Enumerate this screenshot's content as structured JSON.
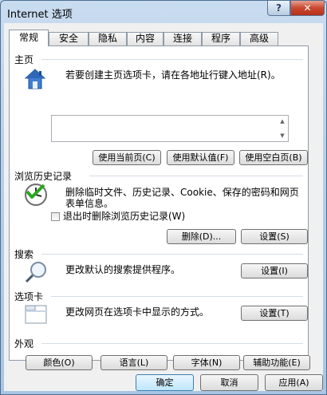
{
  "window": {
    "title": "Internet 选项",
    "help_label": "?",
    "close_label": "✕"
  },
  "tabs": [
    {
      "label": "常规"
    },
    {
      "label": "安全"
    },
    {
      "label": "隐私"
    },
    {
      "label": "内容"
    },
    {
      "label": "连接"
    },
    {
      "label": "程序"
    },
    {
      "label": "高级"
    }
  ],
  "home": {
    "title": "主页",
    "description": "若要创建主页选项卡，请在各地址行键入地址(R)。",
    "url_value": "",
    "buttons": {
      "use_current": "使用当前页(C)",
      "use_default": "使用默认值(F)",
      "use_blank": "使用空白页(B)"
    }
  },
  "history": {
    "title": "浏览历史记录",
    "description_line1": "删除临时文件、历史记录、Cookie、保存的密码和网页",
    "description_line2": "表单信息。",
    "checkbox_label": "退出时删除浏览历史记录(W)",
    "checkbox_checked": false,
    "delete_button": "删除(D)...",
    "settings_button": "设置(S)"
  },
  "search": {
    "title": "搜索",
    "description": "更改默认的搜索提供程序。",
    "settings_button": "设置(I)"
  },
  "tabs_section": {
    "title": "选项卡",
    "description": "更改网页在选项卡中显示的方式。",
    "settings_button": "设置(T)"
  },
  "appearance": {
    "title": "外观",
    "colors_button": "颜色(O)",
    "languages_button": "语言(L)",
    "fonts_button": "字体(N)",
    "accessibility_button": "辅助功能(E)"
  },
  "footer": {
    "ok_button": "确定",
    "cancel_button": "取消",
    "apply_button": "应用(A)"
  }
}
